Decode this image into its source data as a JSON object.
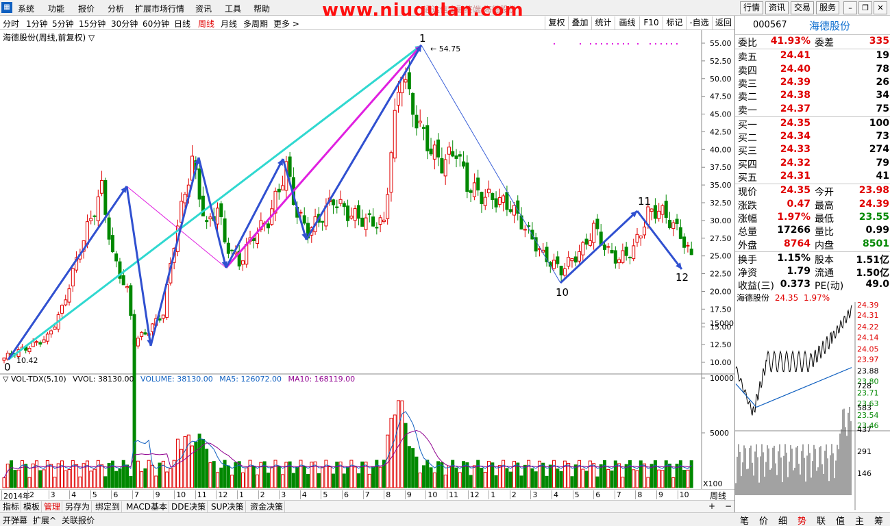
{
  "menubar": {
    "items": [
      "系统",
      "功能",
      "报价",
      "分析",
      "扩展市场行情",
      "资讯",
      "工具",
      "帮助"
    ],
    "faint_title": "通达信金融终端 海德股份",
    "right_buttons": [
      "行情",
      "资讯",
      "交易",
      "服务"
    ]
  },
  "watermark": "www.niugulan.com",
  "periodbar": {
    "periods": [
      "分时",
      "1分钟",
      "5分钟",
      "15分钟",
      "30分钟",
      "60分钟",
      "日线",
      "周线",
      "月线",
      "多周期",
      "更多 >"
    ],
    "active": "周线",
    "tools": [
      "复权",
      "叠加",
      "统计",
      "画线",
      "F10",
      "标记",
      "-自选",
      "返回"
    ]
  },
  "chart": {
    "title": "海德股份(周线,前复权) ▽",
    "high_label": "54.75",
    "low_label": "10.42",
    "y_axis": [
      "55.00",
      "52.50",
      "50.00",
      "47.50",
      "45.00",
      "42.50",
      "40.00",
      "37.50",
      "35.00",
      "32.50",
      "30.00",
      "27.50",
      "25.00",
      "22.50",
      "20.00",
      "17.50",
      "15.00",
      "12.50",
      "10.00"
    ],
    "wave_labels": [
      "0",
      "1",
      "10",
      "11",
      "12"
    ]
  },
  "volume": {
    "indicator": "▽ VOL-TDX(5,10)",
    "vvol": "VVOL: 38130.00",
    "volume_label": "VOLUME: 38130.00",
    "ma5": "MA5: 126072.00",
    "ma10": "MA10: 168119.00",
    "y_axis": [
      "15000",
      "10000",
      "5000"
    ],
    "unit": "X100"
  },
  "datebar": {
    "labels": [
      "2014年",
      "2",
      "3",
      "4",
      "5",
      "6",
      "7",
      "9",
      "10",
      "11",
      "12",
      "1",
      "2",
      "3",
      "4",
      "5",
      "6",
      "7",
      "8",
      "9",
      "10",
      "11",
      "12",
      "1",
      "2",
      "3",
      "4",
      "5",
      "6",
      "7",
      "8",
      "9",
      "10"
    ],
    "right_label": "周线"
  },
  "tabs": [
    "指标",
    "模板",
    "管理",
    "另存为",
    "绑定到",
    "MACD基本",
    "DDE决策",
    "SUP决策",
    "资金决策"
  ],
  "active_tab": "管理",
  "statusbar": [
    "开弹幕",
    "扩展^",
    "关联报价"
  ],
  "quote": {
    "code": "000567",
    "name": "海德股份",
    "weibi": {
      "label": "委比",
      "value": "41.93%",
      "label2": "委差",
      "value2": "335"
    },
    "sell": [
      {
        "label": "卖五",
        "price": "24.41",
        "vol": "19"
      },
      {
        "label": "卖四",
        "price": "24.40",
        "vol": "78"
      },
      {
        "label": "卖三",
        "price": "24.39",
        "vol": "26"
      },
      {
        "label": "卖二",
        "price": "24.38",
        "vol": "34"
      },
      {
        "label": "卖一",
        "price": "24.37",
        "vol": "75"
      }
    ],
    "buy": [
      {
        "label": "买一",
        "price": "24.35",
        "vol": "100"
      },
      {
        "label": "买二",
        "price": "24.34",
        "vol": "73"
      },
      {
        "label": "买三",
        "price": "24.33",
        "vol": "274"
      },
      {
        "label": "买四",
        "price": "24.32",
        "vol": "79"
      },
      {
        "label": "买五",
        "price": "24.31",
        "vol": "41"
      }
    ],
    "stats": [
      {
        "l1": "现价",
        "v1": "24.35",
        "l2": "今开",
        "v2": "23.98"
      },
      {
        "l1": "涨跌",
        "v1": "0.47",
        "l2": "最高",
        "v2": "24.39"
      },
      {
        "l1": "涨幅",
        "v1": "1.97%",
        "l2": "最低",
        "v2": "23.55"
      },
      {
        "l1": "总量",
        "v1": "17266",
        "l2": "量比",
        "v2": "0.99"
      },
      {
        "l1": "外盘",
        "v1": "8764",
        "l2": "内盘",
        "v2": "8501"
      }
    ],
    "stats2": [
      {
        "l1": "换手",
        "v1": "1.15%",
        "l2": "股本",
        "v2": "1.51亿"
      },
      {
        "l1": "净资",
        "v1": "1.79",
        "l2": "流通",
        "v2": "1.50亿"
      },
      {
        "l1": "收益(三)",
        "v1": "0.373",
        "l2": "PE(动)",
        "v2": "49.0"
      }
    ]
  },
  "mini": {
    "name": "海德股份",
    "price": "24.35",
    "pct": "1.97%",
    "y_axis": [
      "24.39",
      "24.31",
      "24.22",
      "24.14",
      "24.05",
      "23.97",
      "23.88",
      "23.80",
      "23.71",
      "23.63",
      "23.54",
      "23.46"
    ],
    "vol_axis": [
      "728",
      "583",
      "437",
      "291",
      "146"
    ]
  },
  "right_tabs": [
    "笔",
    "价",
    "细",
    "势",
    "联",
    "值",
    "主",
    "筹"
  ],
  "right_tab_active": "势",
  "colors": {
    "up": "#e00000",
    "down": "#008800",
    "wave": "#3050d0",
    "cyan": "#30d8d0",
    "magenta": "#e020e0"
  }
}
